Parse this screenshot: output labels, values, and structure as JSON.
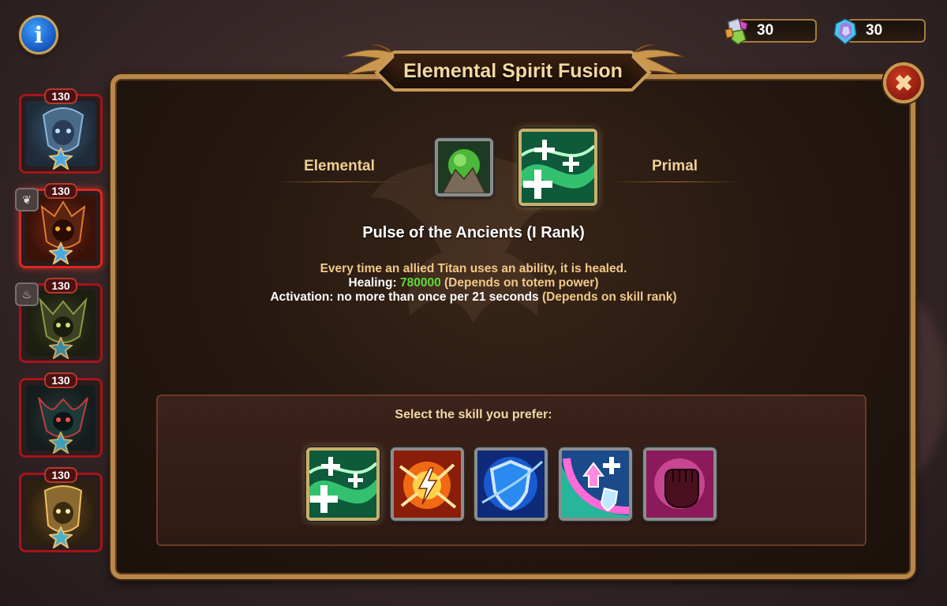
{
  "window": {
    "title": "Elemental Spirit Fusion"
  },
  "header": {
    "info_icon": "info-icon",
    "currencies": [
      {
        "name": "elemental-crystal-icon",
        "value": "30"
      },
      {
        "name": "primal-crystal-icon",
        "value": "30"
      }
    ]
  },
  "sidebar": {
    "totems": [
      {
        "level": "130",
        "element": "water",
        "badge_icon": ""
      },
      {
        "level": "130",
        "element": "earth",
        "badge_icon": "leaf-icon",
        "selected": true
      },
      {
        "level": "130",
        "element": "fire",
        "badge_icon": "flame-icon"
      },
      {
        "level": "130",
        "element": "dark",
        "badge_icon": ""
      },
      {
        "level": "130",
        "element": "light",
        "badge_icon": ""
      }
    ]
  },
  "panel": {
    "left_label": "Elemental",
    "right_label": "Primal",
    "skill_name": "Pulse of the Ancients (I Rank)",
    "description": {
      "line1": "Every time an allied Titan uses an ability, it is healed.",
      "healing_label": "Healing:",
      "healing_value": "780000",
      "healing_note": "(Depends on totem power)",
      "activation": "Activation: no more than once per 21 seconds",
      "activation_note": "(Depends on skill rank)"
    },
    "select_label": "Select the skill you prefer:",
    "skills": [
      {
        "icon": "healing-wave-icon"
      },
      {
        "icon": "lightning-burst-icon"
      },
      {
        "icon": "shield-icon"
      },
      {
        "icon": "buff-shield-icon"
      },
      {
        "icon": "fist-icon"
      }
    ]
  },
  "colors": {
    "accent_gold": "#c79a58",
    "heal_green": "#5ddc3a",
    "tan_text": "#f2c98a"
  }
}
